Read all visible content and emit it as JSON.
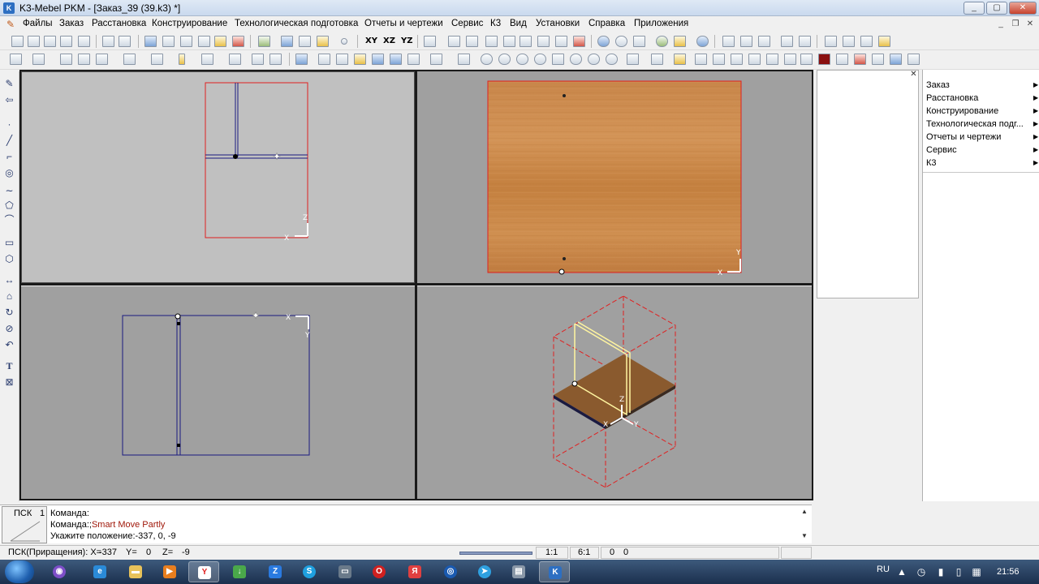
{
  "window": {
    "title": "K3-Mebel PKM - [Заказ_39 (39.k3) *]",
    "app_icon": "k3-app-icon",
    "controls": [
      "minimize",
      "maximize",
      "close"
    ]
  },
  "menu": {
    "items": [
      "Файлы",
      "Заказ",
      "Расстановка",
      "Конструирование",
      "Технологическая подготовка",
      "Отчеты и чертежи",
      "Сервис",
      "К3",
      "Вид",
      "Установки",
      "Справка",
      "Приложения"
    ]
  },
  "toolbar1": {
    "axis_labels": [
      "XY",
      "XZ",
      "YZ"
    ]
  },
  "right_menu": {
    "items": [
      "Заказ",
      "Расстановка",
      "Конструирование",
      "Технологическая подг...",
      "Отчеты и чертежи",
      "Сервис",
      "К3"
    ]
  },
  "command": {
    "psk_label": "ПСК",
    "psk_number": "1",
    "line1": "Команда:",
    "line2_prefix": "Команда:;",
    "line2_cmd": "Smart Move Partly",
    "line3": "Укажите положение:-337, 0, -9"
  },
  "status": {
    "psk": "ПСК(Приращения): X=",
    "x": "-337",
    "y_label": "Y=",
    "y": "0",
    "z_label": "Z=",
    "z": "-9",
    "scale1": "1:1",
    "scale2": "6:1",
    "val1": "0",
    "val2": "0"
  },
  "taskbar": {
    "lang": "RU",
    "clock": "21:56"
  },
  "colors": {
    "wood": "#c8864a",
    "frame_red": "#e02020",
    "line_blue": "#1a1a80",
    "viewport_bg": "#a0a0a0",
    "cmd_red": "#a0180a"
  }
}
